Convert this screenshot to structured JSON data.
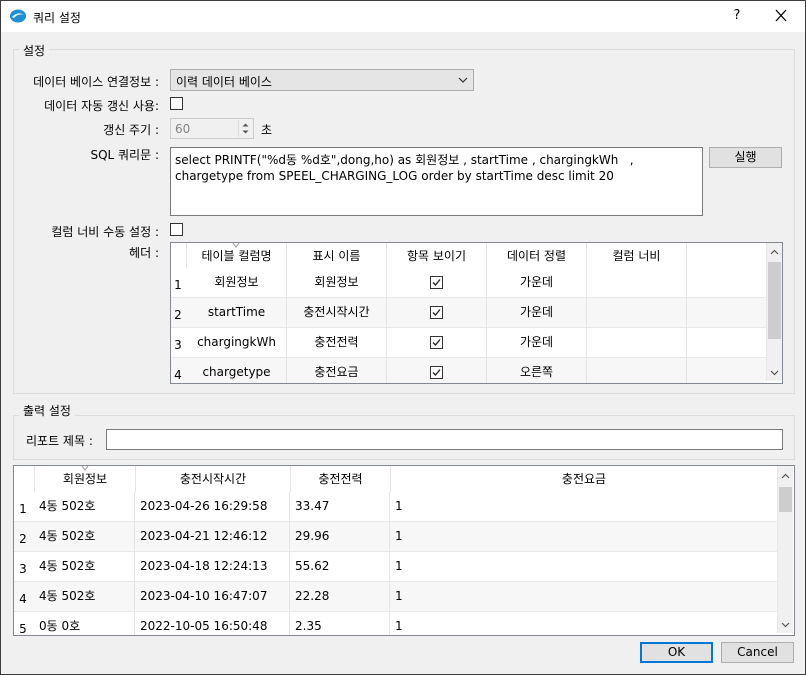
{
  "window": {
    "title": "쿼리 설정",
    "help_label": "?"
  },
  "settings": {
    "legend": "설정",
    "db_label": "데이터 베이스 연결정보 :",
    "db_value": "이력 데이터 베이스",
    "auto_refresh_label": "데이터 자동 갱신 사용:",
    "auto_refresh_checked": false,
    "period_label": "갱신 주기 :",
    "period_value": "60",
    "period_unit": "초",
    "sql_label": "SQL 쿼리문 :",
    "sql_text": "select PRINTF(\"%d동 %d호\",dong,ho) as 회원정보 , startTime , chargingkWh   , chargetype from SPEEL_CHARGING_LOG order by startTime desc limit 20",
    "run_label": "실행",
    "col_width_label": "컬럼 너비 수동 설정 :",
    "col_width_checked": false,
    "header_label": "헤더 :"
  },
  "header_grid": {
    "columns": [
      "테이블 컬럼명",
      "표시 이름",
      "항목 보이기",
      "데이터 정렬",
      "컬럼 너비"
    ],
    "rows": [
      {
        "n": "1",
        "col": "회원정보",
        "display": "회원정보",
        "visible": true,
        "align": "가운데",
        "width": ""
      },
      {
        "n": "2",
        "col": "startTime",
        "display": "충전시작시간",
        "visible": true,
        "align": "가운데",
        "width": ""
      },
      {
        "n": "3",
        "col": "chargingkWh",
        "display": "충전전력",
        "visible": true,
        "align": "가운데",
        "width": ""
      },
      {
        "n": "4",
        "col": "chargetype",
        "display": "충전요금",
        "visible": true,
        "align": "오른쪽",
        "width": ""
      }
    ]
  },
  "output": {
    "legend": "출력 설정",
    "report_title_label": "리포트 제목 :",
    "report_title_value": ""
  },
  "result_grid": {
    "columns": [
      "회원정보",
      "충전시작시간",
      "충전전력",
      "충전요금"
    ],
    "rows": [
      {
        "n": "1",
        "c1": "4동 502호",
        "c2": "2023-04-26 16:29:58",
        "c3": "33.47",
        "c4": "1"
      },
      {
        "n": "2",
        "c1": "4동 502호",
        "c2": "2023-04-21 12:46:12",
        "c3": "29.96",
        "c4": "1"
      },
      {
        "n": "3",
        "c1": "4동 502호",
        "c2": "2023-04-18 12:24:13",
        "c3": "55.62",
        "c4": "1"
      },
      {
        "n": "4",
        "c1": "4동 502호",
        "c2": "2023-04-10 16:47:07",
        "c3": "22.28",
        "c4": "1"
      },
      {
        "n": "5",
        "c1": "0동 0호",
        "c2": "2022-10-05 16:50:48",
        "c3": "2.35",
        "c4": "1"
      }
    ]
  },
  "buttons": {
    "ok": "OK",
    "cancel": "Cancel"
  }
}
